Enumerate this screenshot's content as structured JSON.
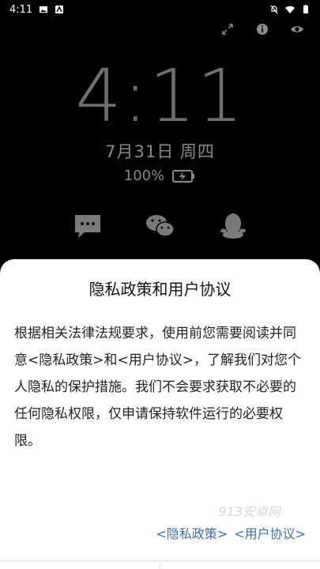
{
  "status_bar": {
    "time": "4:11"
  },
  "lockscreen": {
    "clock": "4:11",
    "date": "7月31日 周四",
    "battery": "100%"
  },
  "dialog": {
    "title": "隐私政策和用户协议",
    "body": "根据相关法律法规要求，使用前您需要阅读并同意<隐私政策>和<用户协议>，了解我们对您个人隐私的保护措施。我们不会要求获取不必要的任何隐私权限，仅申请保持软件运行的必要权限。",
    "watermark": "913安卓网",
    "link_privacy": "<隐私政策>",
    "link_agreement": "<用户协议>"
  },
  "colors": {
    "link": "#3f6fa8",
    "dim_text": "#6f6f6f",
    "sheet_bg": "#ffffff"
  }
}
